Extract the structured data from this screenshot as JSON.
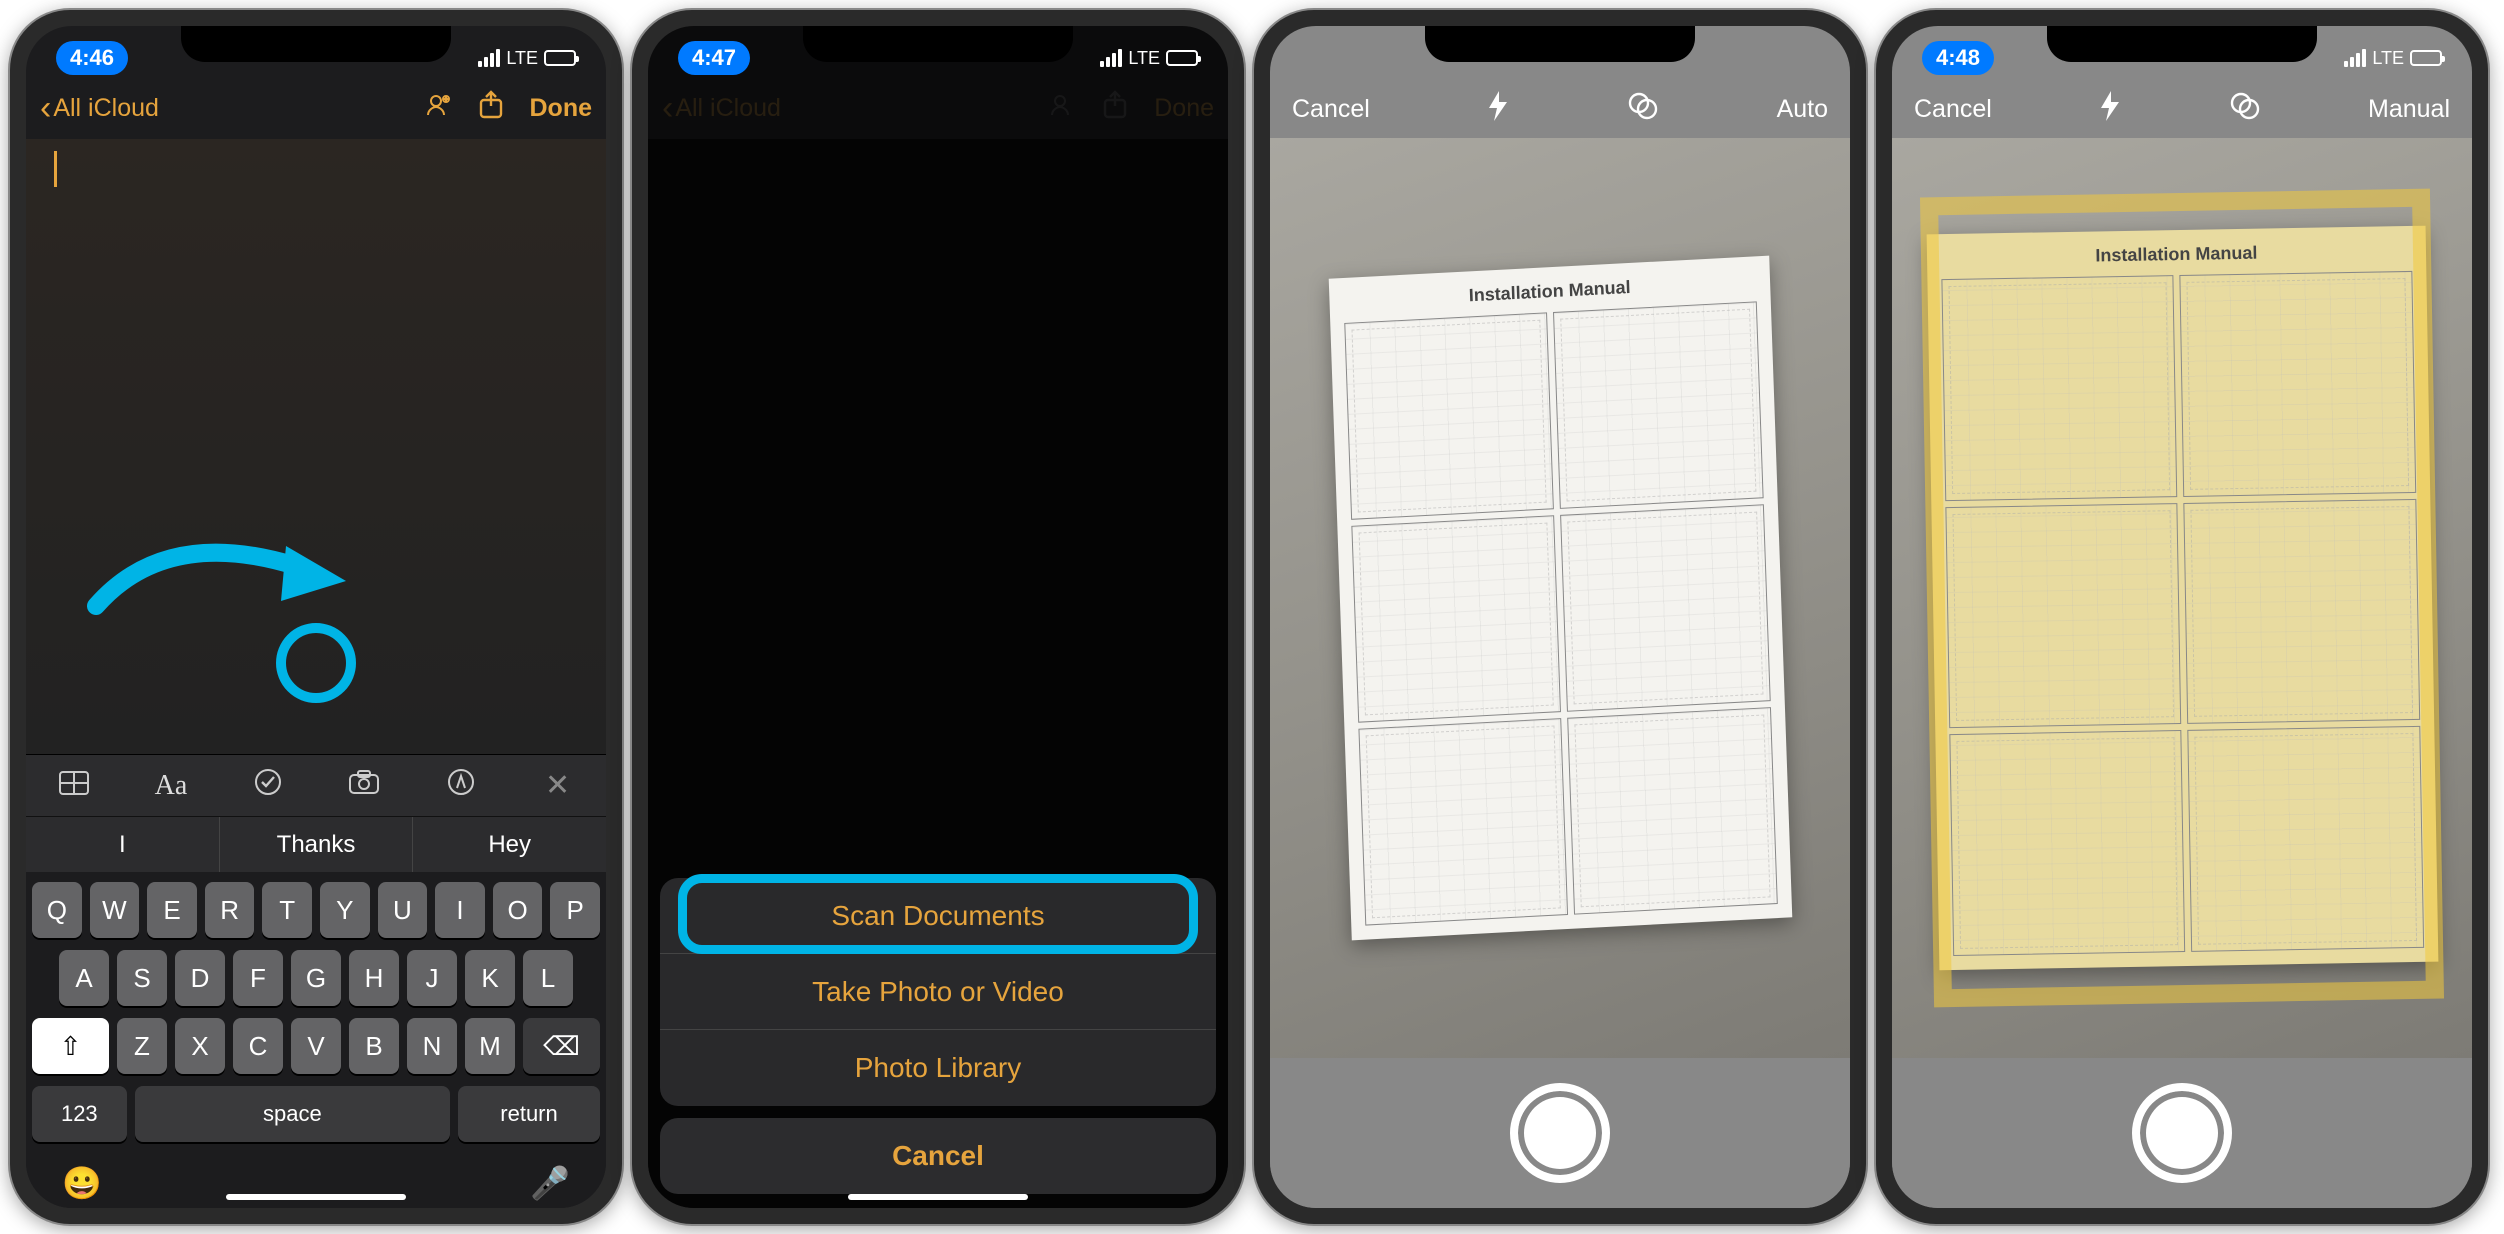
{
  "accent_color": "#00b4e6",
  "notes_tint": "#e6a43d",
  "screens": [
    {
      "time": "4:46",
      "carrier": "LTE",
      "back_label": "All iCloud",
      "done_label": "Done",
      "toolbar_icons": [
        "table-icon",
        "text-style-icon",
        "checklist-icon",
        "camera-icon",
        "markup-icon",
        "close-icon"
      ],
      "suggestions": [
        "I",
        "Thanks",
        "Hey"
      ],
      "keyboard": {
        "rows": [
          [
            "Q",
            "W",
            "E",
            "R",
            "T",
            "Y",
            "U",
            "I",
            "O",
            "P"
          ],
          [
            "A",
            "S",
            "D",
            "F",
            "G",
            "H",
            "J",
            "K",
            "L"
          ],
          [
            "Z",
            "X",
            "C",
            "V",
            "B",
            "N",
            "M"
          ]
        ],
        "shift": "⇧",
        "backspace": "⌫",
        "num_key": "123",
        "space": "space",
        "return": "return",
        "emoji": "😀",
        "mic": "🎤"
      }
    },
    {
      "time": "4:47",
      "carrier": "LTE",
      "back_label": "All iCloud",
      "done_label": "Done",
      "sheet": {
        "scan": "Scan Documents",
        "take_photo": "Take Photo or Video",
        "library": "Photo Library",
        "cancel": "Cancel"
      }
    },
    {
      "cancel": "Cancel",
      "mode": "Auto",
      "doc_title": "Installation Manual"
    },
    {
      "time": "4:48",
      "carrier": "LTE",
      "cancel": "Cancel",
      "mode": "Manual",
      "doc_title": "Installation Manual"
    }
  ]
}
